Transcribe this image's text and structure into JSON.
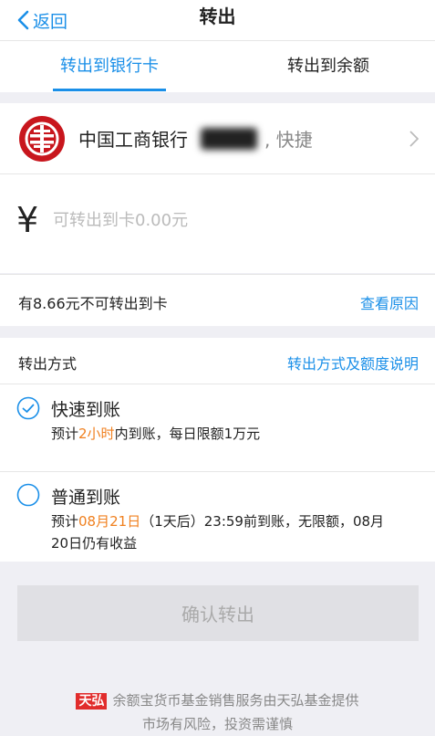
{
  "nav": {
    "back_label": "返回",
    "title": "转出"
  },
  "tabs": [
    {
      "label": "转出到银行卡",
      "active": true
    },
    {
      "label": "转出到余额",
      "active": false
    }
  ],
  "bank": {
    "name": "中国工商银行",
    "suffix": ", 快捷",
    "logo_icon": "icbc-logo-icon"
  },
  "amount": {
    "currency": "¥",
    "placeholder": "可转出到卡0.00元"
  },
  "notice": {
    "text": "有8.66元不可转出到卡",
    "link": "查看原因"
  },
  "method": {
    "title": "转出方式",
    "link": "转出方式及额度说明",
    "options": [
      {
        "title": "快速到账",
        "selected": true,
        "desc_prefix": "预计",
        "desc_highlight": "2小时",
        "desc_suffix": "内到账，每日限额1万元"
      },
      {
        "title": "普通到账",
        "selected": false,
        "desc_prefix": "预计",
        "desc_highlight": "08月21日",
        "desc_suffix": "（1天后）23:59前到账，无限额，08月",
        "desc_line2": "20日仍有收益"
      }
    ]
  },
  "confirm_label": "确认转出",
  "footer": {
    "logo_text": "天弘",
    "line1": "余额宝货币基金销售服务由天弘基金提供",
    "line2": "市场有风险，投资需谨慎"
  },
  "colors": {
    "accent": "#1a8fe8",
    "highlight": "#f0801f",
    "icbc_red": "#c8161d"
  }
}
